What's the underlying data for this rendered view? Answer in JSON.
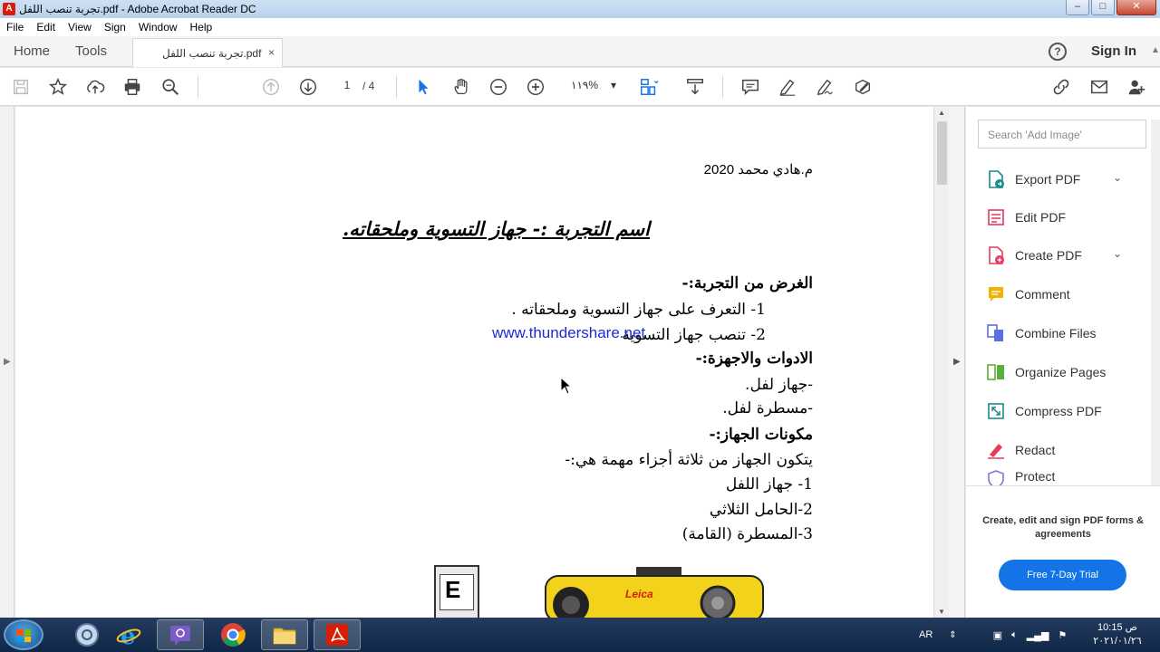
{
  "window": {
    "title": "تجربة تنصب اللفل.pdf - Adobe Acrobat Reader DC"
  },
  "menu": [
    "File",
    "Edit",
    "View",
    "Sign",
    "Window",
    "Help"
  ],
  "tabs": {
    "home": "Home",
    "tools": "Tools",
    "doc": "تجربة تنصب اللفل.pdf",
    "close": "×"
  },
  "header": {
    "signin": "Sign In"
  },
  "toolbar": {
    "page_current": "1",
    "page_total": "/ 4",
    "zoom": "١١٩%"
  },
  "document": {
    "author": "م.هادي محمد 2020",
    "title": "اسم التجربة :- جهاز التسوية وملحقاته.",
    "purpose_heading": "الغرض من التجربة:-",
    "purpose_1": "1-  التعرف على جهاز التسوية وملحقاته .",
    "purpose_2": "2-  تنصب جهاز التسوية",
    "watermark": "www.thundershare.net",
    "tools_heading": "الادوات والاجهزة:-",
    "tools_1": "-جهاز لفل.",
    "tools_2": "-مسطرة لفل.",
    "components_heading": "مكونات الجهاز:-",
    "components_intro": "يتكون الجهاز من ثلاثة أجزاء مهمة هي:-",
    "component_1": "1- جهاز اللفل",
    "component_2": "2-الحامل الثلاثي",
    "component_3": "3-المسطرة (القامة)",
    "staff_mark": "E",
    "level_brand": "Leica"
  },
  "right_pane": {
    "search_placeholder": "Search 'Add Image'",
    "items": [
      {
        "label": "Export PDF",
        "icon": "export-pdf-icon",
        "color": "#1c8a8a"
      },
      {
        "label": "Edit PDF",
        "icon": "edit-pdf-icon",
        "color": "#e6395c"
      },
      {
        "label": "Create PDF",
        "icon": "create-pdf-icon",
        "color": "#e6395c"
      },
      {
        "label": "Comment",
        "icon": "comment-icon",
        "color": "#f0b400"
      },
      {
        "label": "Combine Files",
        "icon": "combine-files-icon",
        "color": "#5b6ee6"
      },
      {
        "label": "Organize Pages",
        "icon": "organize-pages-icon",
        "color": "#5cae3a"
      },
      {
        "label": "Compress PDF",
        "icon": "compress-pdf-icon",
        "color": "#1c8a8a"
      },
      {
        "label": "Redact",
        "icon": "redact-icon",
        "color": "#e6395c"
      },
      {
        "label": "Protect",
        "icon": "protect-icon",
        "color": "#8b6fd6"
      }
    ],
    "promo": "Create, edit and sign PDF forms & agreements",
    "trial_button": "Free 7-Day Trial"
  },
  "taskbar": {
    "lang": "AR",
    "time": "10:15 ص",
    "date": "٢٠٢١/٠١/٢٦"
  },
  "colors": {
    "accent": "#1473e6",
    "acrobat_red": "#d81e06"
  }
}
